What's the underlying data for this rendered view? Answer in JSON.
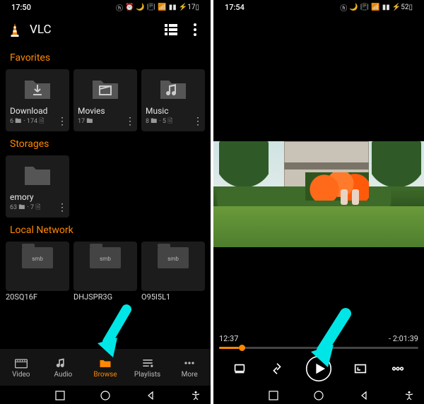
{
  "left": {
    "status": {
      "time": "17:50",
      "battery": "17"
    },
    "app": {
      "title": "VLC"
    },
    "sections": {
      "favorites": {
        "title": "Favorites",
        "items": [
          {
            "label": "Download",
            "meta1": "6 🖿",
            "meta2": "· 174 🗎",
            "icon": "download"
          },
          {
            "label": "Movies",
            "meta1": "17 🖿",
            "meta2": "",
            "icon": "movies"
          },
          {
            "label": "Music",
            "meta1": "8 🖿",
            "meta2": "· 5 🗎",
            "icon": "music"
          }
        ]
      },
      "storages": {
        "title": "Storages",
        "items": [
          {
            "label": "emory",
            "meta1": "63 🖿",
            "meta2": "· 7 🗎",
            "icon": "plain"
          }
        ]
      },
      "local_network": {
        "title": "Local Network",
        "items": [
          {
            "tag": "smb",
            "label": "20SQ16F"
          },
          {
            "tag": "smb",
            "label": "DHJSPR3G"
          },
          {
            "tag": "smb",
            "label": "O95I5L1"
          }
        ]
      }
    },
    "nav": {
      "video": "Video",
      "audio": "Audio",
      "browse": "Browse",
      "playlists": "Playlists",
      "more": "More"
    }
  },
  "right": {
    "status": {
      "time": "17:54",
      "battery": "52"
    },
    "player": {
      "elapsed": "12:37",
      "remaining": "- 2:01:39"
    }
  }
}
